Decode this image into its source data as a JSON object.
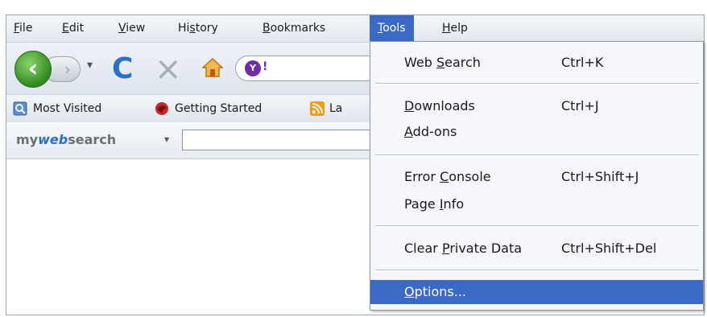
{
  "menubar": {
    "items": [
      {
        "label": "File",
        "ul": "F",
        "rest": "ile"
      },
      {
        "label": "Edit",
        "ul": "E",
        "rest": "dit"
      },
      {
        "label": "View",
        "ul": "V",
        "rest": "iew"
      },
      {
        "label": "History",
        "pre": "Hi",
        "ul": "s",
        "rest": "tory"
      },
      {
        "label": "Bookmarks",
        "ul": "B",
        "rest": "ookmarks"
      },
      {
        "label": "Tools",
        "ul": "T",
        "rest": "ools"
      },
      {
        "label": "Help",
        "ul": "H",
        "rest": "elp"
      }
    ]
  },
  "navbar": {
    "back_glyph": "‹",
    "forward_glyph": "›",
    "dropdown_glyph": "▾",
    "reload_glyph": "C",
    "stop_glyph": "×",
    "yahoo_letter": "Y",
    "yahoo_ex": "!"
  },
  "bookmarks": {
    "items": [
      "Most Visited",
      "Getting Started",
      "La"
    ]
  },
  "searchbar": {
    "brand_my": "my",
    "brand_web": "web",
    "brand_search": "search",
    "dropdown_glyph": "▾",
    "query": ""
  },
  "tools_menu": {
    "items": [
      {
        "pre": "Web ",
        "ul": "S",
        "rest": "earch",
        "shortcut": "Ctrl+K"
      },
      {
        "pre": "",
        "ul": "D",
        "rest": "ownloads",
        "shortcut": "Ctrl+J"
      },
      {
        "pre": "",
        "ul": "A",
        "rest": "dd-ons",
        "shortcut": ""
      },
      {
        "pre": "Error ",
        "ul": "C",
        "rest": "onsole",
        "shortcut": "Ctrl+Shift+J"
      },
      {
        "pre": "Page ",
        "ul": "I",
        "rest": "nfo",
        "shortcut": ""
      },
      {
        "pre": "Clear ",
        "ul": "P",
        "rest": "rivate Data",
        "shortcut": "Ctrl+Shift+Del"
      },
      {
        "pre": "",
        "ul": "O",
        "rest": "ptions...",
        "shortcut": ""
      }
    ],
    "selected_index": 6
  },
  "colors": {
    "selection": "#3a69c6",
    "back_button": "#2f8a1f",
    "reload": "#2a6fc9"
  }
}
